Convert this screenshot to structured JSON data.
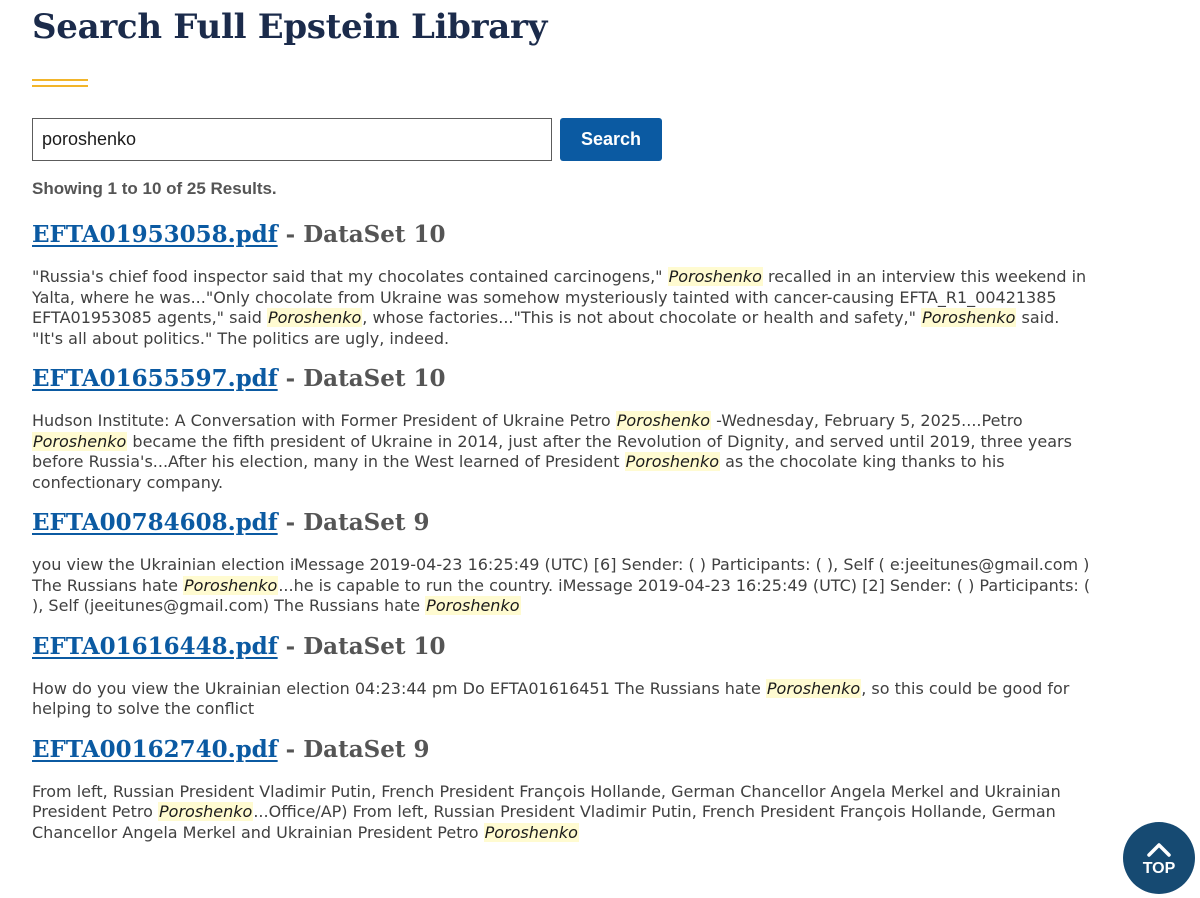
{
  "page": {
    "title": "Search Full Epstein Library"
  },
  "search": {
    "value": "poroshenko",
    "button_label": "Search"
  },
  "summary": "Showing 1 to 10 of 25 Results.",
  "results": [
    {
      "filename": "EFTA01953058.pdf",
      "dataset": " - DataSet 10",
      "snippet": [
        "\"Russia's chief food inspector said that my chocolates contained carcinogens,\" ",
        {
          "hl": "Poroshenko"
        },
        " recalled in an interview this weekend in Yalta, where he was...\"Only chocolate from Ukraine was somehow mysteriously tainted with cancer-causing EFTA_R1_00421385 EFTA01953085 agents,\" said ",
        {
          "hl": "Poroshenko"
        },
        ", whose factories...\"This is not about chocolate or health and safety,\" ",
        {
          "hl": "Poroshenko"
        },
        " said. \"It's all about politics.\" The politics are ugly, indeed."
      ]
    },
    {
      "filename": "EFTA01655597.pdf",
      "dataset": " - DataSet 10",
      "snippet": [
        "Hudson Institute: A Conversation with Former President of Ukraine Petro ",
        {
          "hl": "Poroshenko"
        },
        " -Wednesday, February 5, 2025....Petro ",
        {
          "hl": "Poroshenko"
        },
        " became the fifth president of Ukraine in 2014, just after the Revolution of Dignity, and served until 2019, three years before Russia's...After his election, many in the West learned of President ",
        {
          "hl": "Poroshenko"
        },
        " as the chocolate king thanks to his confectionary company."
      ]
    },
    {
      "filename": "EFTA00784608.pdf",
      "dataset": " - DataSet 9",
      "snippet": [
        "you view the Ukrainian election iMessage 2019-04-23 16:25:49 (UTC) [6] Sender: ( ) Participants: ( ), Self ( e:jeeitunes@gmail.com ) The Russians hate ",
        {
          "hl": "Poroshenko"
        },
        "...he is capable to run the country. iMessage 2019-04-23 16:25:49 (UTC) [2] Sender: ( ) Participants: ( ), Self (jeeitunes@gmail.com) The Russians hate ",
        {
          "hl": "Poroshenko"
        }
      ]
    },
    {
      "filename": "EFTA01616448.pdf",
      "dataset": " - DataSet 10",
      "snippet": [
        "How do you view the Ukrainian election 04:23:44 pm Do EFTA01616451 The Russians hate ",
        {
          "hl": "Poroshenko"
        },
        ", so this could be good for helping to solve the conflict"
      ]
    },
    {
      "filename": "EFTA00162740.pdf",
      "dataset": " - DataSet 9",
      "snippet": [
        "From left, Russian President Vladimir Putin, French President François Hollande, German Chancellor Angela Merkel and Ukrainian President Petro ",
        {
          "hl": "Poroshenko"
        },
        "...Office/AP) From left, Russian President Vladimir Putin, French President François Hollande, German Chancellor Angela Merkel and Ukrainian President Petro ",
        {
          "hl": "Poroshenko"
        }
      ]
    }
  ],
  "back_to_top": {
    "icon": "chevron-up-icon",
    "label": "TOP"
  },
  "colors": {
    "title": "#1b2b4b",
    "accent_rule": "#f2b52a",
    "link": "#0b5aa2",
    "button": "#0b5aa2",
    "highlight": "#fffbd1",
    "top_button": "#164a72"
  }
}
